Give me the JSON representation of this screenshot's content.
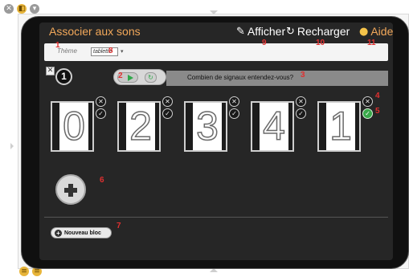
{
  "app": {
    "title": "Associer aux sons",
    "afficher_label": "Afficher",
    "recharger_label": "Recharger",
    "aide_label": "Aide"
  },
  "theme": {
    "label": "Thème",
    "selected": "tablette"
  },
  "exercise": {
    "item_number": "1",
    "question": "Combien de signaux entendez-vous?"
  },
  "cards": [
    {
      "digit": "0",
      "correct": false
    },
    {
      "digit": "2",
      "correct": false
    },
    {
      "digit": "3",
      "correct": false
    },
    {
      "digit": "4",
      "correct": false
    },
    {
      "digit": "1",
      "correct": true
    }
  ],
  "footer": {
    "new_block_label": "Nouveau bloc"
  },
  "annotations": [
    "1",
    "2",
    "3",
    "4",
    "5",
    "6",
    "7",
    "8",
    "9",
    "10",
    "11"
  ],
  "icons": {
    "pencil": "pencil-icon",
    "reload": "reload-icon",
    "bulb": "lightbulb-icon",
    "play": "play-icon",
    "plus": "plus-icon",
    "close": "close-icon",
    "check": "check-icon"
  },
  "colors": {
    "accent_orange": "#f2a85a",
    "success_green": "#39a84a",
    "annotation_red": "#e03030",
    "screen_bg": "#262626"
  }
}
